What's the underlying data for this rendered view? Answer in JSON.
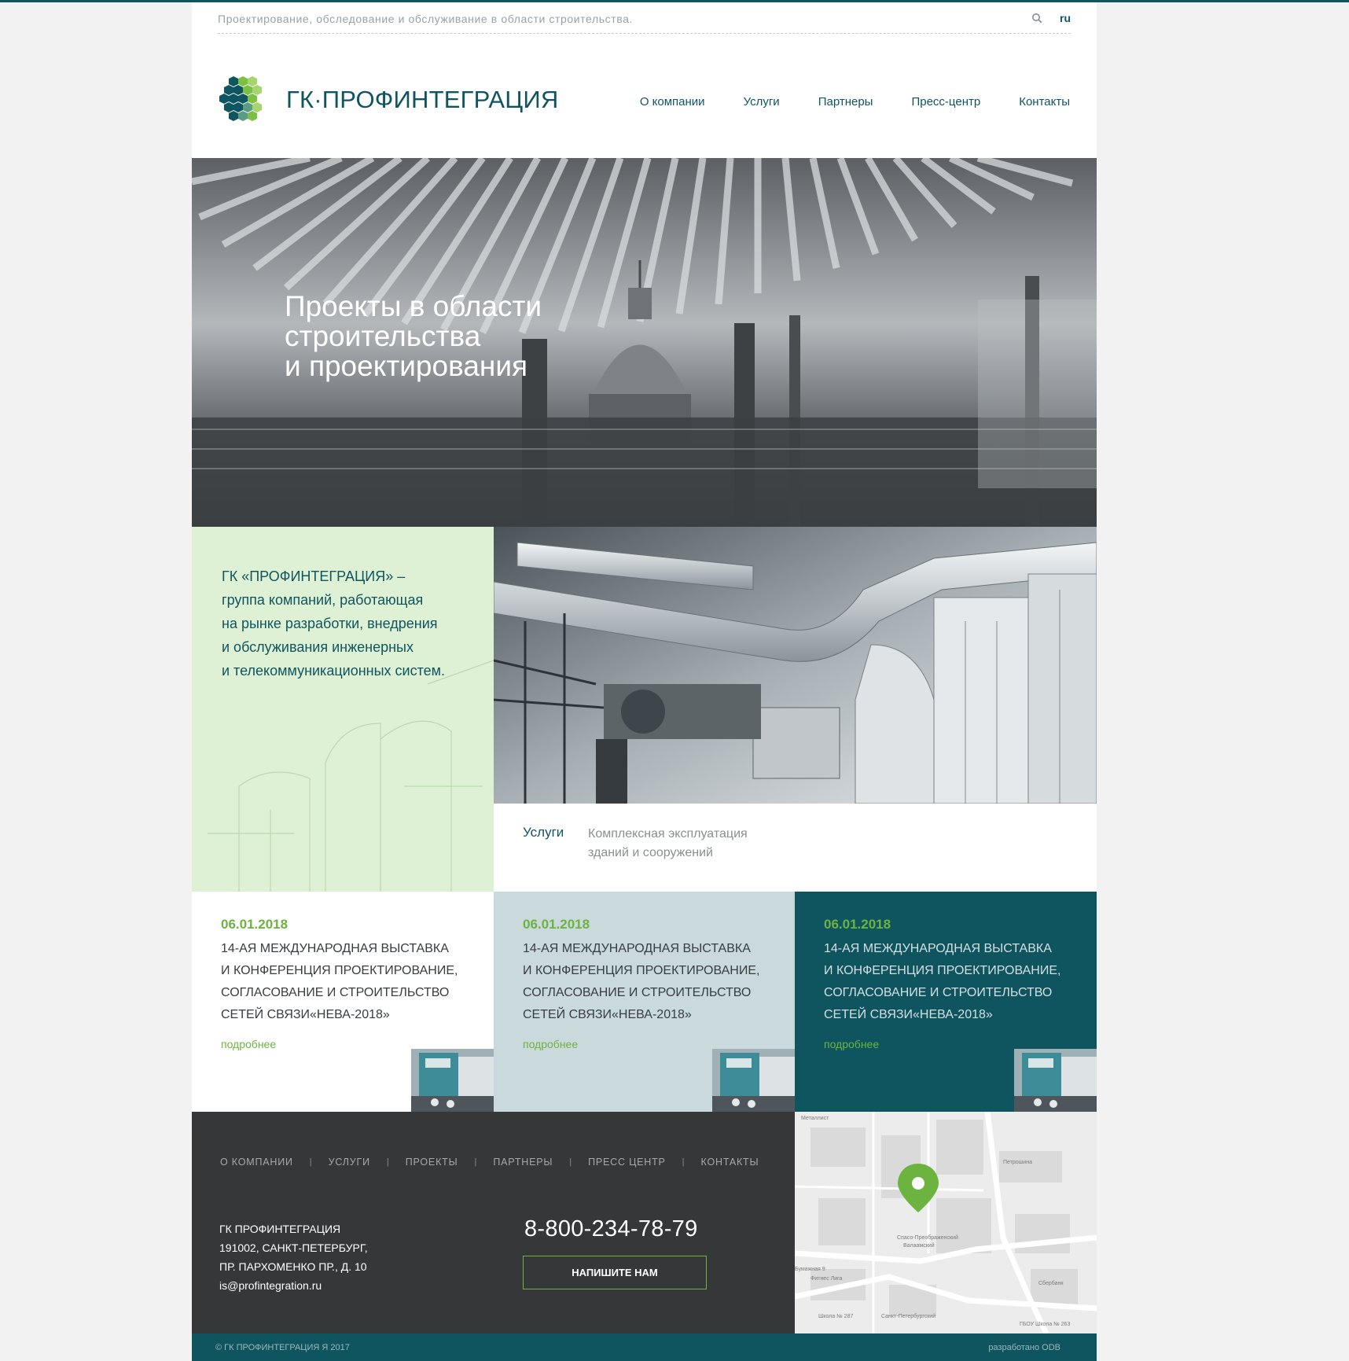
{
  "topbar": {
    "tagline": "Проектирование, обследование и обслуживание в области строительства.",
    "search_icon": "search-icon",
    "lang": "ru"
  },
  "header": {
    "logo_text": "ГК·ПРОФИНТЕГРАЦИЯ",
    "nav": [
      "О компании",
      "Услуги",
      "Партнеры",
      "Пресс-центр",
      "Контакты"
    ]
  },
  "hero": {
    "title_line1": "Проекты в области",
    "title_line2": "строительства",
    "title_line3": "и проектирования"
  },
  "about": {
    "company": "ГК «ПРОФИНТЕГРАЦИЯ» –",
    "line2": "группа компаний, работающая",
    "line3": "на рынке разработки, внедрения",
    "line4": "и обслуживания инженерных",
    "line5": "и телекоммуникационных систем."
  },
  "services": {
    "label": "Услуги",
    "desc_line1": "Комплексная эксплуатация",
    "desc_line2": "зданий и сооружений"
  },
  "news": [
    {
      "date": "06.01.2018",
      "title_l1": "14-ая международная выставка",
      "title_l2": "и конференция проектирование,",
      "title_l3": "согласование и строительство",
      "title_l4": "сетей связи«НЕВА-2018»",
      "more": "подробнее"
    },
    {
      "date": "06.01.2018",
      "title_l1": "14-ая международная выставка",
      "title_l2": "и конференция проектирование,",
      "title_l3": "согласование и строительство",
      "title_l4": "сетей связи«НЕВА-2018»",
      "more": "подробнее"
    },
    {
      "date": "06.01.2018",
      "title_l1": "14-ая международная выставка",
      "title_l2": "и конференция проектирование,",
      "title_l3": "согласование и строительство",
      "title_l4": "сетей связи«НЕВА-2018»",
      "more": "подробнее"
    }
  ],
  "footer": {
    "nav": [
      "О КОМПАНИИ",
      "УСЛУГИ",
      "ПРОЕКТЫ",
      "ПАРТНЕРЫ",
      "ПРЕСС ЦЕНТР",
      "КОНТАКТЫ"
    ],
    "separator": "|",
    "company": "ГК ПРОФИНТЕГРАЦИЯ",
    "address1": "191002, САНКТ-ПЕТЕРБУРГ,",
    "address2": "ПР. ПАРХОМЕНКО ПР., Д. 10",
    "email": "is@profintegration.ru",
    "phone": "8-800-234-78-79",
    "button": "НАПИШИТЕ НАМ"
  },
  "map": {
    "labels": [
      "Металлист",
      "Петрошина",
      "Спасо-Преображенский",
      "Валаамский",
      "Бумажная 9",
      "Фитнес Лига",
      "Сбербанк",
      "Школа № 287",
      "Санкт-Петербургский",
      "ГБОУ Школа № 263"
    ]
  },
  "bottom": {
    "copyright": "© ГК ПРОФИНТЕГРАЦИЯ Я 2017",
    "developer": "разработано ODB"
  },
  "colors": {
    "brand": "#0f5560",
    "accent": "#6db33f",
    "about_bg": "#dff1d5",
    "news_mid_bg": "#c9d9dc",
    "footer_bg": "#363739"
  }
}
